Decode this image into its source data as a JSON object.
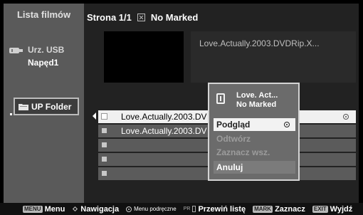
{
  "sidebar": {
    "title": "Lista filmów",
    "usb_label": "Urz. USB",
    "drive_label": "Napęd1",
    "up_folder_label": "UP Folder"
  },
  "header": {
    "page_label": "Strona 1/1",
    "marked_label": "No Marked"
  },
  "info": {
    "filename": "Love.Actually.2003.DVDRip.X..."
  },
  "files": [
    {
      "name": "Love.Actually.2003.DV"
    },
    {
      "name": "Love.Actually.2003.DV"
    },
    {
      "name": ""
    },
    {
      "name": ""
    },
    {
      "name": ""
    }
  ],
  "popup": {
    "title_line1": "Love. Act...",
    "title_line2": "No Marked",
    "items": [
      "Podgląd",
      "Odtwórz",
      "Zaznacz wsz.",
      "Anuluj"
    ]
  },
  "bottom_bar": {
    "menu_key": "MENU",
    "menu_text": "Menu",
    "nav_text": "Nawigacja",
    "context_text": "Menu podręczne",
    "pr_key": "PR",
    "scroll_text": "Przewiń listę",
    "mark_key": "MARK",
    "mark_text": "Zaznacz",
    "exit_key": "EXIT",
    "exit_text": "Wyjdź"
  }
}
